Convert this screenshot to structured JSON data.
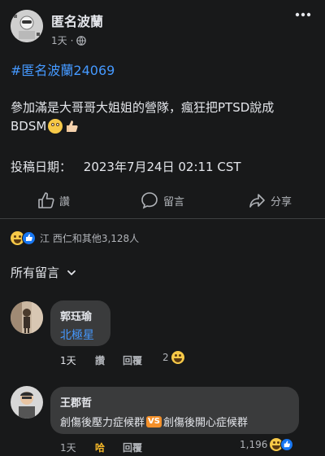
{
  "post": {
    "author": "匿名波蘭",
    "time": "1天",
    "privacy_icon": "globe-icon",
    "menu_icon": "more-dots-icon",
    "hashtag": "#匿名波蘭24069",
    "body_line1": "參加滿是大哥哥大姐姐的營隊，瘋狂把PTSD說成",
    "body_line2": "BDSM",
    "post_date_label": "投稿日期：",
    "post_date_value": "2023年7月24日 02:11 CST"
  },
  "actions": {
    "like_label": "讚",
    "comment_label": "留言",
    "share_label": "分享"
  },
  "reactions": {
    "summary": "江 西仁和其他3,128人"
  },
  "comments_header": {
    "label": "所有留言"
  },
  "comments": [
    {
      "name": "郭珏瑜",
      "text": "北極星",
      "time": "1天",
      "like": "讚",
      "reply": "回覆",
      "reaction_count": "2"
    },
    {
      "name": "王郡哲",
      "text_a": "創傷後壓力症候群",
      "vs": "VS",
      "text_b": "創傷後開心症候群",
      "time": "1天",
      "like": "哈",
      "reply": "回覆",
      "reaction_count": "1,196"
    }
  ],
  "colors": {
    "background": "#18191a",
    "bubble": "#3a3b3c",
    "link_blue": "#4599ff",
    "text": "#e4e6eb",
    "muted": "#b0b3b8"
  }
}
